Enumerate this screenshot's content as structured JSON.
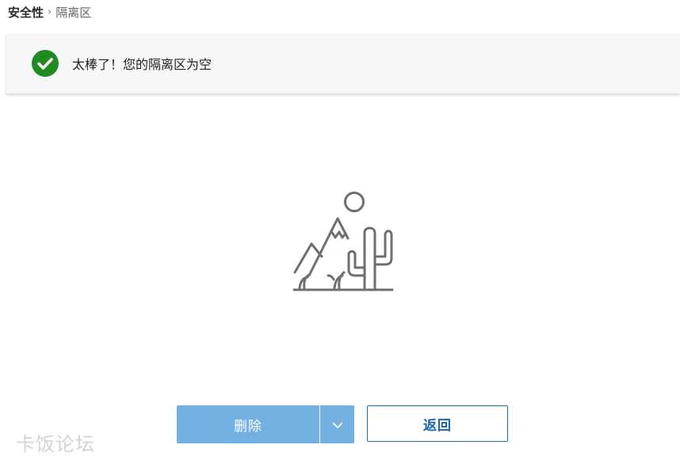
{
  "breadcrumb": {
    "parent": "安全性",
    "separator": "›",
    "current": "隔离区"
  },
  "banner": {
    "icon": "check-circle-icon",
    "message": "太棒了！您的隔离区为空"
  },
  "empty_state": {
    "illustration": "desert-cactus-illustration"
  },
  "actions": {
    "delete_label": "删除",
    "dropdown_icon": "chevron-down-icon",
    "back_label": "返回"
  },
  "watermark": {
    "text": "卡饭论坛"
  },
  "colors": {
    "success": "#1f8a1f",
    "primary_disabled": "#73b1e2",
    "primary": "#1a64a8"
  }
}
